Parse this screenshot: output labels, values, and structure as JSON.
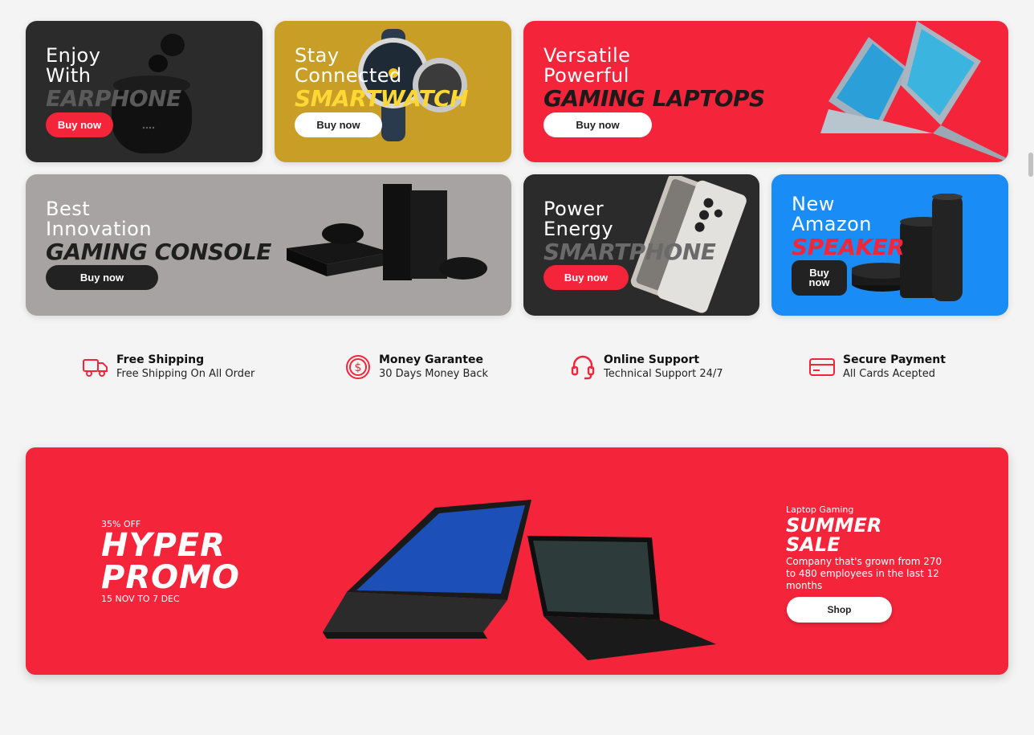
{
  "colors": {
    "accent_red": "#f4253a",
    "dark": "#2b2b2b",
    "gold": "#c99e27",
    "gray": "#a7a3a3",
    "blue": "#1a8cf5"
  },
  "banners": {
    "earphone": {
      "line1": "Enjoy",
      "line2": "With",
      "headline": "EARPHONE",
      "button": "Buy now"
    },
    "smartwatch": {
      "line1": "Stay",
      "line2": "Connected",
      "headline": "SMARTWATCH",
      "button": "Buy now"
    },
    "laptops": {
      "line1": "Versatile",
      "line2": "Powerful",
      "headline": "GAMING LAPTOPS",
      "button": "Buy now"
    },
    "console": {
      "line1": "Best",
      "line2": "Innovation",
      "headline": "GAMING CONSOLE",
      "button": "Buy now"
    },
    "smartphone": {
      "line1": "Power",
      "line2": "Energy",
      "headline": "SMARTPHONE",
      "button": "Buy now"
    },
    "speaker": {
      "line1": "New",
      "line2": "Amazon",
      "headline": "SPEAKER",
      "button": "Buy now"
    }
  },
  "features": [
    {
      "icon": "truck-icon",
      "title": "Free Shipping",
      "subtitle": "Free Shipping On All Order"
    },
    {
      "icon": "dollar-icon",
      "title": "Money Garantee",
      "subtitle": "30 Days Money Back"
    },
    {
      "icon": "headset-icon",
      "title": "Online Support",
      "subtitle": "Technical Support 24/7"
    },
    {
      "icon": "credit-card-icon",
      "title": "Secure Payment",
      "subtitle": "All Cards Acepted"
    }
  ],
  "promo": {
    "discount": "35% OFF",
    "title_line1": "HYPER",
    "title_line2": "PROMO",
    "dates": "15 NOV TO 7 DEC",
    "kicker": "Laptop Gaming",
    "headline_line1": "SUMMER",
    "headline_line2": "SALE",
    "description": "Company that's grown from 270 to 480 employees in the last 12 months",
    "button": "Shop"
  }
}
